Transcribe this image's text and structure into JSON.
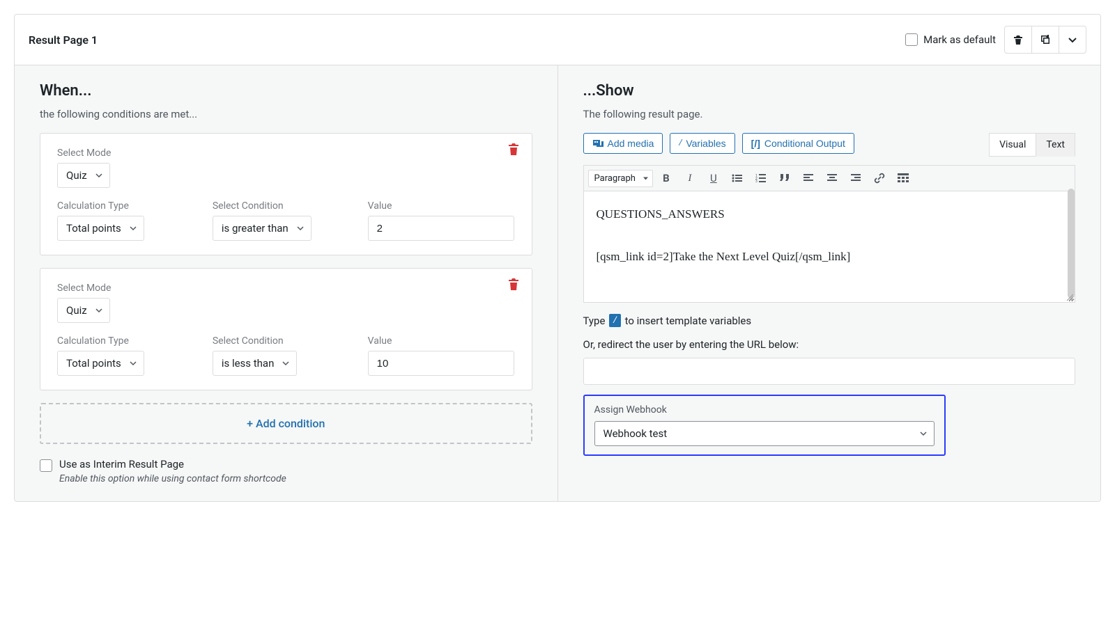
{
  "header": {
    "title": "Result Page 1",
    "mark_default_label": "Mark as default"
  },
  "when": {
    "heading": "When...",
    "subtext": "the following conditions are met...",
    "conditions": [
      {
        "mode_label": "Select Mode",
        "mode_value": "Quiz",
        "calc_label": "Calculation Type",
        "calc_value": "Total points",
        "cond_label": "Select Condition",
        "cond_value": "is greater than",
        "value_label": "Value",
        "value": "2"
      },
      {
        "mode_label": "Select Mode",
        "mode_value": "Quiz",
        "calc_label": "Calculation Type",
        "calc_value": "Total points",
        "cond_label": "Select Condition",
        "cond_value": "is less than",
        "value_label": "Value",
        "value": "10"
      }
    ],
    "add_condition": "+ Add condition",
    "interim_label": "Use as Interim Result Page",
    "interim_note": "Enable this option while using contact form shortcode"
  },
  "show": {
    "heading": "...Show",
    "subtext": "The following result page.",
    "buttons": {
      "add_media": "Add media",
      "variables": "Variables",
      "conditional": "Conditional Output"
    },
    "tabs": {
      "visual": "Visual",
      "text": "Text"
    },
    "toolbar": {
      "format": "Paragraph"
    },
    "editor_content": "QUESTIONS_ANSWERS\n\n[qsm_link id=2]Take the Next Level Quiz[/qsm_link]",
    "type_hint_pre": "Type",
    "type_hint_badge": "/",
    "type_hint_post": "to insert template variables",
    "redirect_label": "Or, redirect the user by entering the URL below:",
    "redirect_value": "",
    "webhook_label": "Assign Webhook",
    "webhook_value": "Webhook test"
  }
}
